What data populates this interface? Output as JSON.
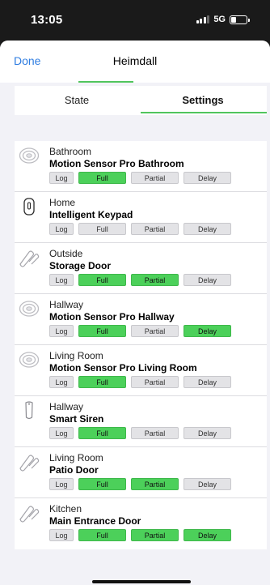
{
  "status_bar": {
    "time": "13:05",
    "network": "5G",
    "signal_bars": 3,
    "battery_level": 0.35
  },
  "nav": {
    "done_label": "Done",
    "title": "Heimdall"
  },
  "tabs": [
    {
      "label": "State",
      "active": false
    },
    {
      "label": "Settings",
      "active": true
    }
  ],
  "colors": {
    "accent_green": "#51c55d",
    "active_mode": "#4cd05a",
    "link_blue": "#2f7de1"
  },
  "devices": [
    {
      "room": "Bathroom",
      "name": "Motion Sensor Pro Bathroom",
      "icon": "motion-sensor-icon",
      "modes": {
        "log": false,
        "full": true,
        "partial": false,
        "delay": false
      }
    },
    {
      "room": "Home",
      "name": "Intelligent Keypad",
      "icon": "keypad-icon",
      "modes": {
        "log": false,
        "full": false,
        "partial": false,
        "delay": false
      }
    },
    {
      "room": "Outside",
      "name": "Storage Door",
      "icon": "door-sensor-icon",
      "modes": {
        "log": false,
        "full": true,
        "partial": true,
        "delay": false
      }
    },
    {
      "room": "Hallway",
      "name": "Motion Sensor Pro Hallway",
      "icon": "motion-sensor-icon",
      "modes": {
        "log": false,
        "full": true,
        "partial": false,
        "delay": true
      }
    },
    {
      "room": "Living Room",
      "name": "Motion Sensor Pro Living Room",
      "icon": "motion-sensor-icon",
      "modes": {
        "log": false,
        "full": true,
        "partial": false,
        "delay": false
      }
    },
    {
      "room": "Hallway",
      "name": "Smart Siren",
      "icon": "siren-icon",
      "modes": {
        "log": false,
        "full": true,
        "partial": false,
        "delay": false
      }
    },
    {
      "room": "Living Room",
      "name": "Patio Door",
      "icon": "door-sensor-icon",
      "modes": {
        "log": false,
        "full": true,
        "partial": true,
        "delay": false
      }
    },
    {
      "room": "Kitchen",
      "name": "Main Entrance Door",
      "icon": "door-sensor-icon",
      "modes": {
        "log": false,
        "full": true,
        "partial": true,
        "delay": true
      }
    }
  ],
  "mode_labels": {
    "log": "Log",
    "full": "Full",
    "partial": "Partial",
    "delay": "Delay"
  }
}
